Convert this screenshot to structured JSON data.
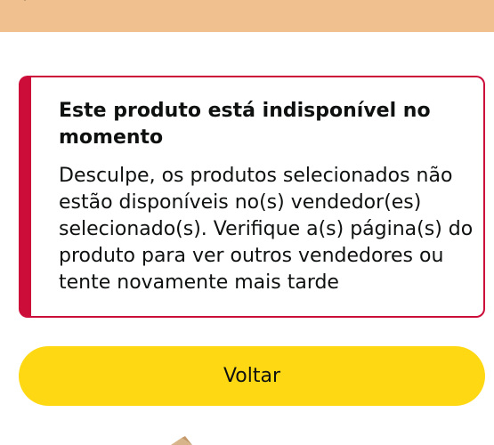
{
  "alert": {
    "title": "Este produto está indisponível no momento",
    "message": "Desculpe, os produtos selecionados não estão disponíveis no(s) vendedor(es) selecionado(s). Verifique a(s) página(s) do produto para ver outros vendedores ou tente novamente mais tarde"
  },
  "actions": {
    "back_label": "Voltar"
  },
  "icons": {
    "top_bar": "chevron-icon",
    "bottom": "package-icon"
  },
  "colors": {
    "header": "#f0c18e",
    "alert_accent": "#cc0c39",
    "button": "#ffd814",
    "text": "#0f1111"
  }
}
